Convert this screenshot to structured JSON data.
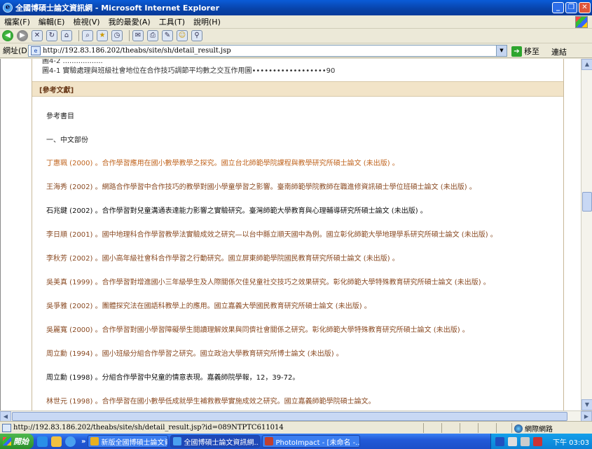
{
  "window": {
    "title": "全國博碩士論文資訊網 - Microsoft Internet Explorer"
  },
  "menu": [
    "檔案(F)",
    "編輯(E)",
    "檢視(V)",
    "我的最愛(A)",
    "工具(T)",
    "說明(H)"
  ],
  "address": {
    "label": "網址(D)",
    "url": "http://192.83.186.202/theabs/site/sh/detail_result.jsp",
    "go_label": "移至",
    "links_label": "連結"
  },
  "content": {
    "top_line1": "圖4-2 ..................",
    "top_line2": "圖4-1 實驗處理與班級社會地位在合作技巧調節平均數之交互作用圖••••••••••••••••••90",
    "references_header": "[參考文獻]",
    "section_title": "參考書目",
    "sub_title": "一、中文部份",
    "references": [
      {
        "text": "丁惠珮 (2000) 。合作學習應用在國小數學教學之探究。國立台北師範學院課程與教學研究所碩士論文 (未出版) 。",
        "color": "#c0641e"
      },
      {
        "text": "王海秀 (2002) 。網路合作學習中合作技巧的教學對國小學童學習之影響。臺南師範學院教師在職進修資訊碩士學位班碩士論文 (未出版) 。",
        "color": "#8a4a22"
      },
      {
        "text": "石兆鍵 (2002) 。合作學習對兒童溝通表達能力影響之實驗研究。臺灣師範大學教育與心理輔導研究所碩士論文 (未出版) 。",
        "color": "#111111"
      },
      {
        "text": "李日順 (2001) 。國中地理科合作學習教學法實驗成效之研究—以台中縣立順天國中為例。國立彰化師範大學地理學系研究所碩士論文 (未出版) 。",
        "color": "#8a4a22"
      },
      {
        "text": "李秋芳 (2002) 。國小高年級社會科合作學習之行動研究。國立屏東師範學院國民教育研究所碩士論文 (未出版) 。",
        "color": "#8a4a22"
      },
      {
        "text": "吳美真 (1999) 。合作學習對增進國小三年級學生及人際關係欠佳兒童社交技巧之效果研究。彰化師範大學特殊教育研究所碩士論文 (未出版) 。",
        "color": "#8a4a22"
      },
      {
        "text": "吳爭雅 (2002) 。團體探究法在國語科教學上的應用。國立嘉義大學國民教育研究所碩士論文 (未出版) 。",
        "color": "#8a4a22"
      },
      {
        "text": "吳麗寬 (2000) 。合作學習對國小學習障礙學生閱讀理解效果與同儕社會關係之研究。彰化師範大學特殊教育研究所碩士論文 (未出版) 。",
        "color": "#8a4a22"
      },
      {
        "text": "周立勳 (1994) 。國小班級分組合作學習之研究。國立政治大學教育研究所博士論文 (未出版) 。",
        "color": "#8a4a22"
      },
      {
        "text": "周立勳 (1998) 。分組合作學習中兒童的情意表現。嘉義師院學報，12，39-72。",
        "color": "#111111"
      },
      {
        "text": "林世元 (1998) 。合作學習在國小數學低成就學生補救教學實施成效之研究。國立嘉義師範學院碩士論文。",
        "color": "#8a4a22"
      }
    ]
  },
  "status": {
    "text": "http://192.83.186.202/theabs/site/sh/detail_result.jsp?id=089NTPTC611014",
    "zone": "網際網路"
  },
  "taskbar": {
    "start": "開始",
    "more": "»",
    "tasks": [
      {
        "label": "新版全國博碩士論文資...",
        "active": false,
        "color": "#e8b020"
      },
      {
        "label": "全國博碩士論文資訊網...",
        "active": true,
        "color": "#4aa0f0"
      },
      {
        "label": "PhotoImpact - [未命名 -...",
        "active": false,
        "color": "#c04030"
      }
    ],
    "clock": "下午 03:03"
  }
}
